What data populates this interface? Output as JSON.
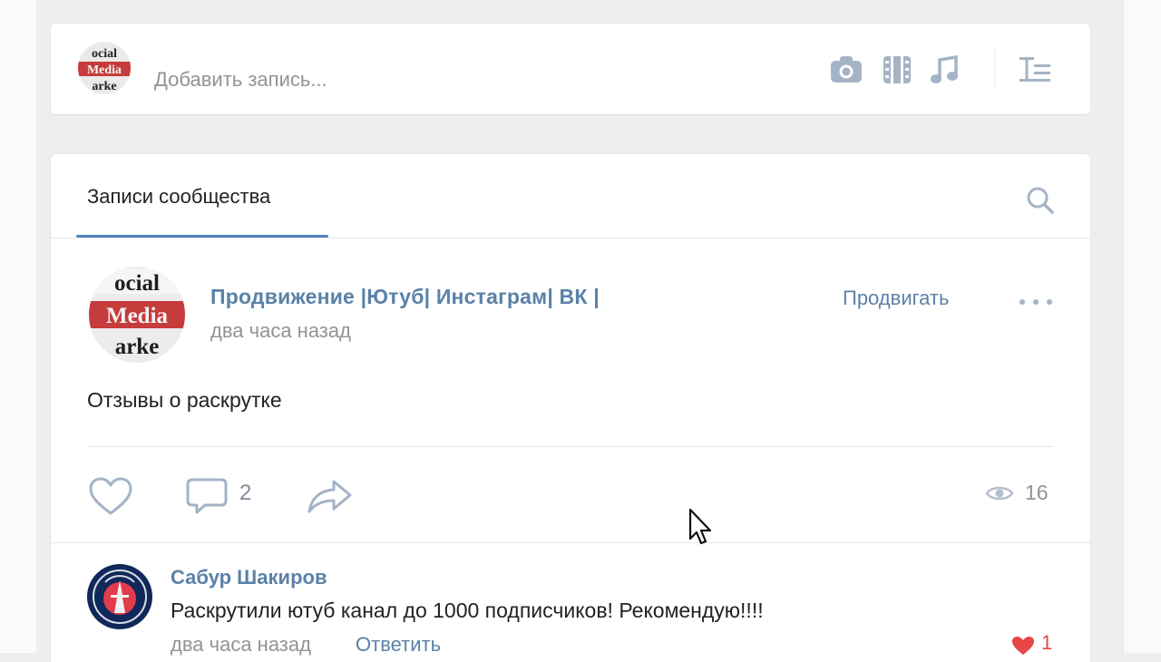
{
  "composer": {
    "placeholder": "Добавить запись...",
    "avatar_words": [
      "ocial",
      "Media",
      "arke"
    ],
    "icons": [
      "camera-icon",
      "video-icon",
      "music-icon",
      "text-format-icon"
    ]
  },
  "wall": {
    "tab_label": "Записи сообщества",
    "post": {
      "author": "Продвижение |Ютуб| Инстаграм| ВК |",
      "time": "два часа назад",
      "promote_label": "Продвигать",
      "text": "Отзывы о раскрутке",
      "avatar_words": [
        "ocial",
        "Media",
        "arke"
      ],
      "comments_count": "2",
      "views_count": "16"
    },
    "comment": {
      "author": "Сабур Шакиров",
      "text": "Раскрутили ютуб канал до 1000 подписчиков! Рекомендую!!!!",
      "time": "два часа назад",
      "reply_label": "Ответить",
      "likes": "1"
    }
  },
  "colors": {
    "background": "#edeef0",
    "link": "#5b81a8",
    "accent": "#5181b8",
    "icon": "#a5b3c6",
    "like_red": "#e64646"
  }
}
